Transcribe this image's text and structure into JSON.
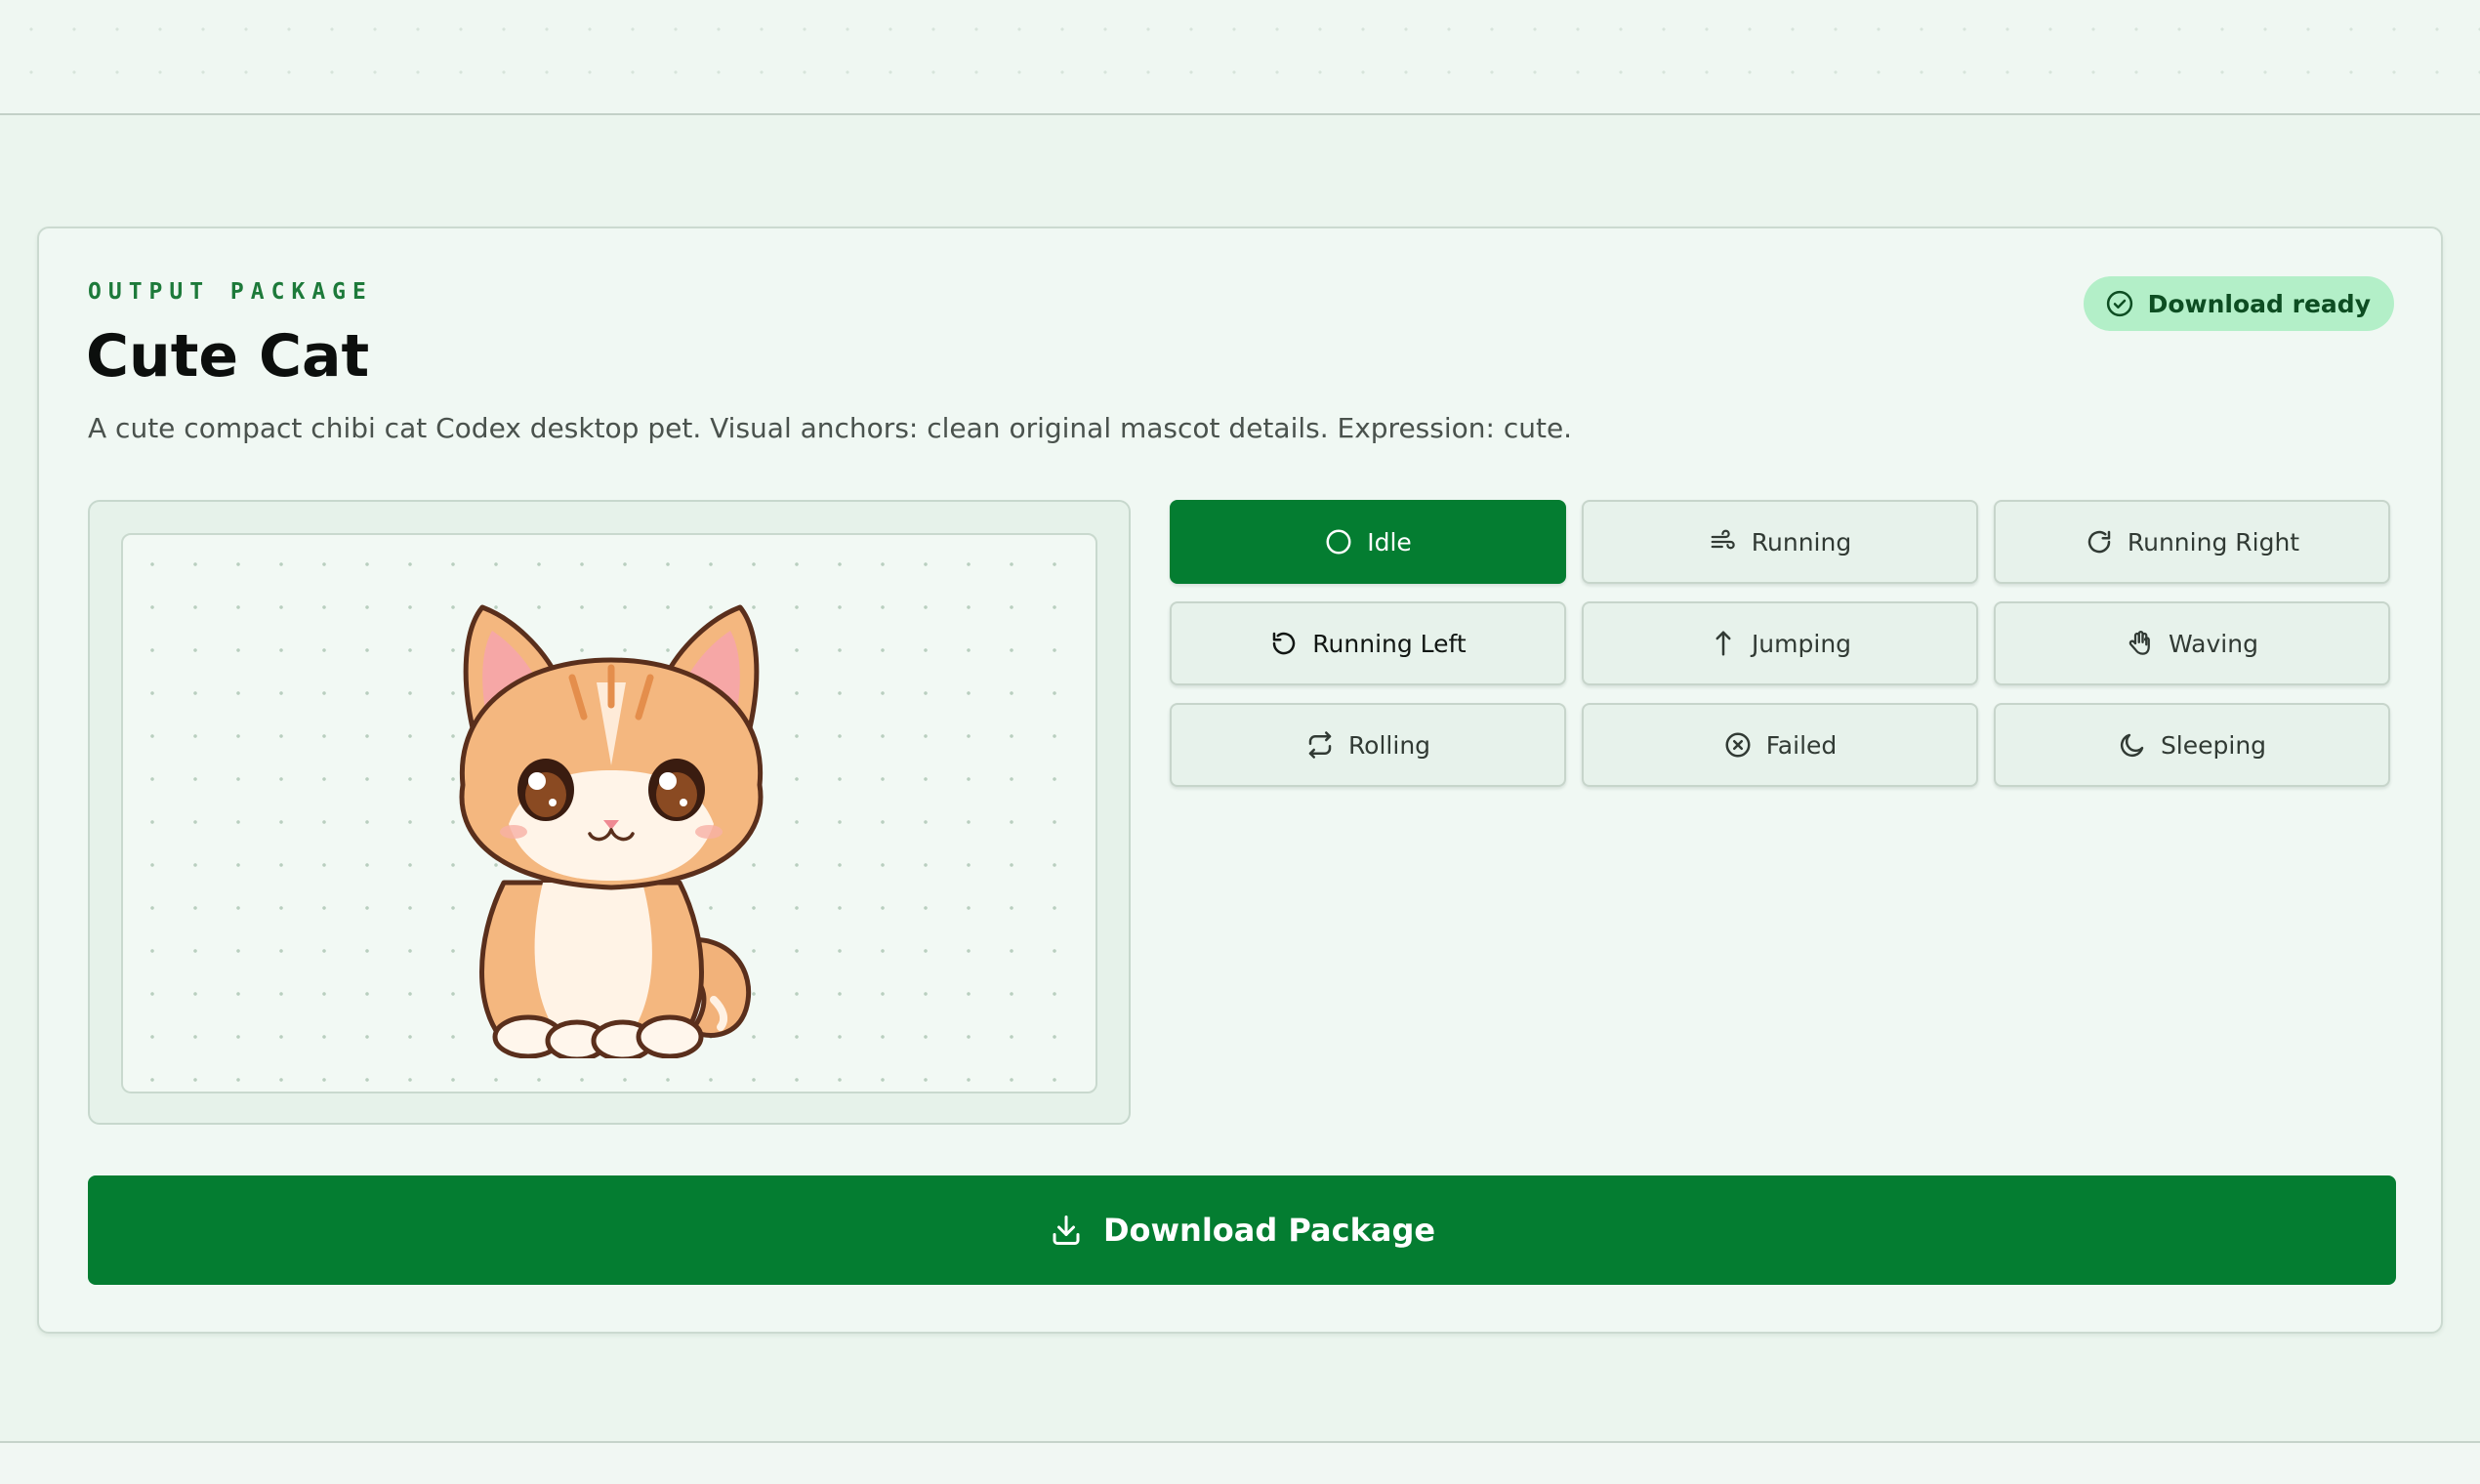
{
  "package": {
    "eyebrow": "OUTPUT PACKAGE",
    "title": "Cute Cat",
    "description": "A cute compact chibi cat Codex desktop pet. Visual anchors: clean original mascot details. Expression: cute.",
    "status_badge": "Download ready",
    "status_icon": "check-circle-icon"
  },
  "preview": {
    "subject": "chibi-orange-cat-sprite"
  },
  "states": [
    {
      "label": "Idle",
      "icon": "circle-icon",
      "active": true
    },
    {
      "label": "Running",
      "icon": "wind-icon",
      "active": false
    },
    {
      "label": "Running Right",
      "icon": "rotate-cw-icon",
      "active": false
    },
    {
      "label": "Running Left",
      "icon": "rotate-ccw-icon",
      "active": false
    },
    {
      "label": "Jumping",
      "icon": "arrow-up-icon",
      "active": false
    },
    {
      "label": "Waving",
      "icon": "hand-icon",
      "active": false
    },
    {
      "label": "Rolling",
      "icon": "repeat-icon",
      "active": false
    },
    {
      "label": "Failed",
      "icon": "x-circle-icon",
      "active": false
    },
    {
      "label": "Sleeping",
      "icon": "moon-icon",
      "active": false
    }
  ],
  "download": {
    "label": "Download Package",
    "icon": "download-icon"
  },
  "colors": {
    "accent": "#047d31",
    "badge_bg": "#b3efc8",
    "page_bg": "#ebf5ee"
  }
}
